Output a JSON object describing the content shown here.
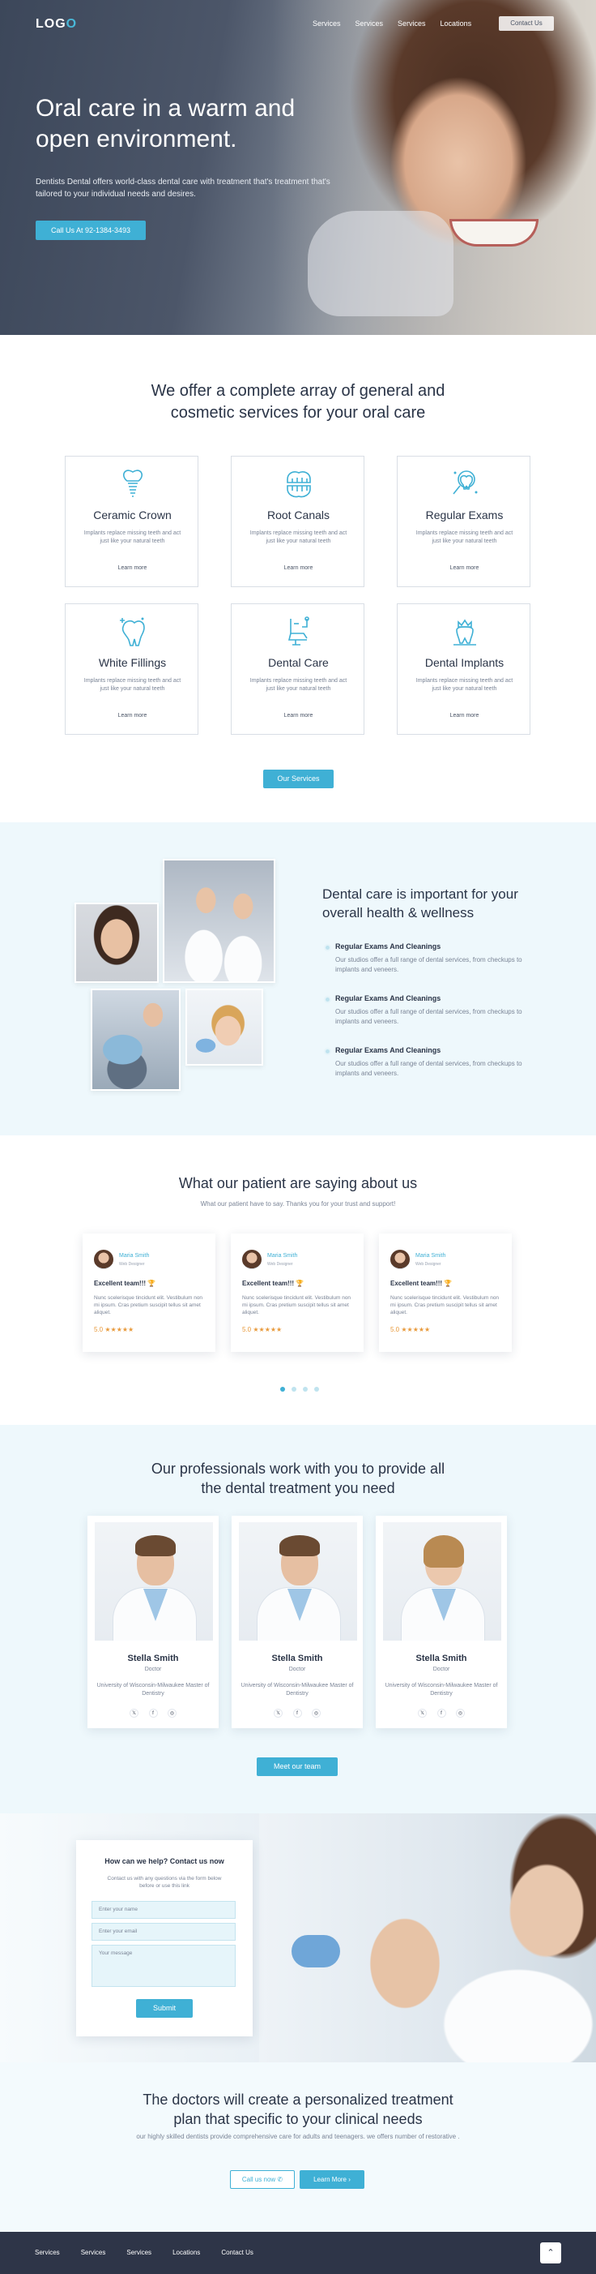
{
  "nav": {
    "logo_prefix": "LOG",
    "logo_suffix": "O",
    "links": [
      "Services",
      "Services",
      "Services",
      "Locations"
    ],
    "contact_label": "Contact Us"
  },
  "hero": {
    "title": "Oral care in a warm and open environment.",
    "text": "Dentists Dental offers world-class dental care with treatment that's treatment that's tailored to your individual needs and desires.",
    "call_label": "Call Us At 92-1384-3493"
  },
  "services": {
    "title": "We offer a complete array of general and cosmetic services for your oral care",
    "items": [
      {
        "name": "Ceramic Crown",
        "desc": "Implants replace missing teeth and act just like your natural teeth",
        "more": "Learn more",
        "icon": "implant-icon"
      },
      {
        "name": "Root Canals",
        "desc": "Implants replace missing teeth and act just like your natural teeth",
        "more": "Learn more",
        "icon": "teeth-icon"
      },
      {
        "name": "Regular Exams",
        "desc": "Implants replace missing teeth and act just like your natural teeth",
        "more": "Learn more",
        "icon": "tooth-magnifier-icon"
      },
      {
        "name": "White Fillings",
        "desc": "Implants replace missing teeth and act just like your natural teeth",
        "more": "Learn more",
        "icon": "tooth-sparkle-icon"
      },
      {
        "name": "Dental Care",
        "desc": "Implants replace missing teeth and act just like your natural teeth",
        "more": "Learn more",
        "icon": "dental-chair-icon"
      },
      {
        "name": "Dental Implants",
        "desc": "Implants replace missing teeth and act just like your natural teeth",
        "more": "Learn more",
        "icon": "tooth-crown-icon"
      }
    ],
    "button_label": "Our Services"
  },
  "care": {
    "title": "Dental care is important for your overall health & wellness",
    "items": [
      {
        "title": "Regular Exams And Cleanings",
        "desc": "Our studios offer a full range of dental services, from checkups to implants and veneers."
      },
      {
        "title": "Regular Exams And Cleanings",
        "desc": "Our studios offer a full range of dental services, from checkups to implants and veneers."
      },
      {
        "title": "Regular Exams And Cleanings",
        "desc": "Our studios offer a full range of dental services, from checkups to implants and veneers."
      }
    ]
  },
  "testimonials": {
    "title": "What our patient are saying about us",
    "subtitle": "What our patient have to say. Thanks you for your trust and support!",
    "cards": [
      {
        "name": "Maria Smith",
        "role": "Web Designer",
        "heading": "Excellent team!!! 🏆",
        "text": "Nunc scelerisque tincidunt elit. Vestibulum non mi ipsum. Cras pretium suscipit tellus sit amet aliquet.",
        "rating": "5.0 ★★★★★"
      },
      {
        "name": "Maria Smith",
        "role": "Web Designer",
        "heading": "Excellent team!!! 🏆",
        "text": "Nunc scelerisque tincidunt elit. Vestibulum non mi ipsum. Cras pretium suscipit tellus sit amet aliquet.",
        "rating": "5.0 ★★★★★"
      },
      {
        "name": "Maria Smith",
        "role": "Web Designer",
        "heading": "Excellent team!!! 🏆",
        "text": "Nunc scelerisque tincidunt elit. Vestibulum non mi ipsum. Cras pretium suscipit tellus sit amet aliquet.",
        "rating": "5.0 ★★★★★"
      }
    ],
    "pages": 4,
    "active_page": 1
  },
  "pros": {
    "title": "Our professionals work with you to provide all the dental treatment you need",
    "cards": [
      {
        "name": "Stella Smith",
        "role": "Doctor",
        "school": "University of Wisconsin-Milwaukee Master of Dentistry"
      },
      {
        "name": "Stella Smith",
        "role": "Doctor",
        "school": "University of Wisconsin-Milwaukee Master of Dentistry"
      },
      {
        "name": "Stella Smith",
        "role": "Doctor",
        "school": "University of Wisconsin-Milwaukee Master of Dentistry"
      }
    ],
    "social": [
      "𝕏",
      "f",
      "◎"
    ],
    "button_label": "Meet our team"
  },
  "contact": {
    "title": "How can we help? Contact us now",
    "subtitle": "Contact us with any questions via the form below before or use this link",
    "name_placeholder": "Enter your name",
    "email_placeholder": "Enter your email",
    "message_placeholder": "Your message",
    "submit_label": "Submit"
  },
  "plan": {
    "title": "The doctors will create a personalized treatment plan that specific to your clinical needs",
    "text": "our highly skilled dentists provide comprehensive care for adults and teenagers. we offers number of restorative .",
    "call_label": "Call us now ✆",
    "learn_label": "Learn More ›"
  },
  "footer": {
    "links": [
      "Services",
      "Services",
      "Services",
      "Locations",
      "Contact Us"
    ],
    "totop": "⌃"
  },
  "colors": {
    "accent": "#3fb0d5",
    "dark": "#2e3548",
    "light_bg": "#eef8fc",
    "star": "#e89a3c"
  }
}
